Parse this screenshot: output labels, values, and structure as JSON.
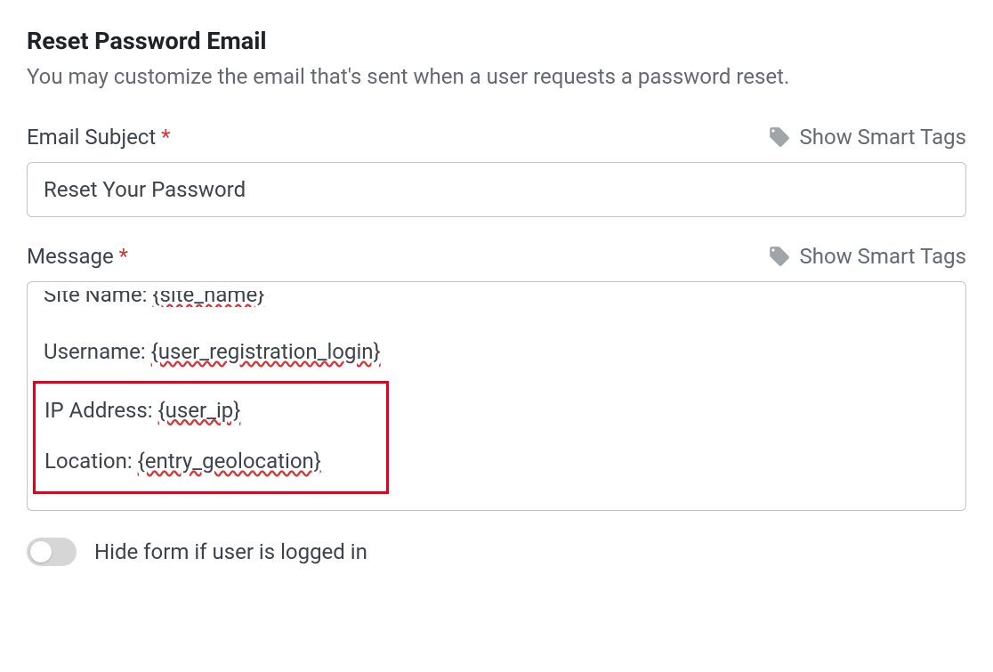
{
  "section": {
    "title": "Reset Password Email",
    "description": "You may customize the email that's sent when a user requests a password reset."
  },
  "emailSubject": {
    "label": "Email Subject",
    "required": "*",
    "smartTagsLabel": "Show Smart Tags",
    "value": "Reset Your Password"
  },
  "message": {
    "label": "Message",
    "required": "*",
    "smartTagsLabel": "Show Smart Tags",
    "lines": {
      "cutPrefix": "Site Name: ",
      "cutTag": "{site_name}",
      "usernamePrefix": "Username: ",
      "usernameTag": "{user_registration_login}",
      "ipPrefix": "IP Address: ",
      "ipTag": "{user_ip}",
      "locationPrefix": "Location: ",
      "locationTag": "{entry_geolocation}"
    }
  },
  "toggle": {
    "label": "Hide form if user is logged in"
  }
}
